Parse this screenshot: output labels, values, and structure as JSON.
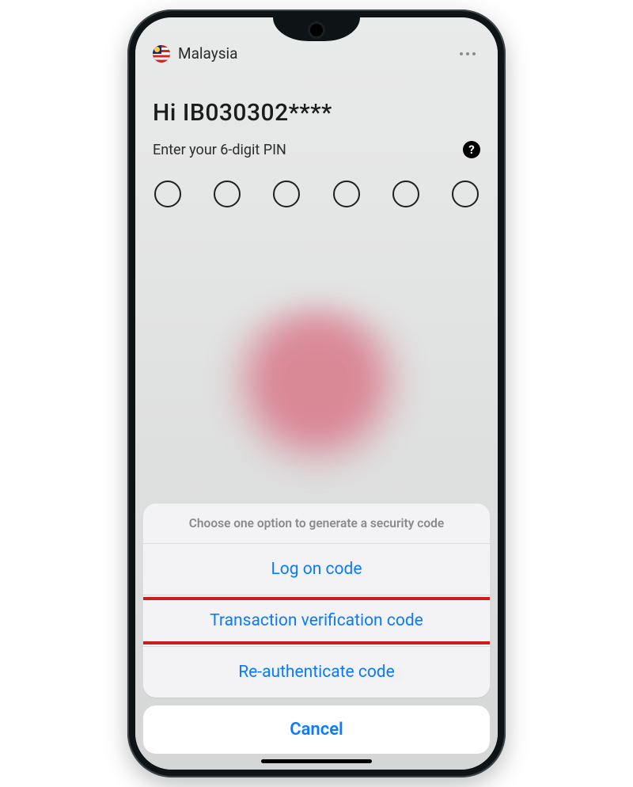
{
  "header": {
    "country_label": "Malaysia"
  },
  "login": {
    "greeting": "Hi IB030302****",
    "pin_prompt": "Enter your 6-digit PIN"
  },
  "action_sheet": {
    "title": "Choose one option to generate a security code",
    "options": [
      {
        "label": "Log on code"
      },
      {
        "label": "Transaction verification code",
        "highlighted": true
      },
      {
        "label": "Re-authenticate code"
      }
    ],
    "cancel_label": "Cancel"
  },
  "colors": {
    "ios_blue": "#0a7aff",
    "highlight_red": "#c81e1e"
  }
}
